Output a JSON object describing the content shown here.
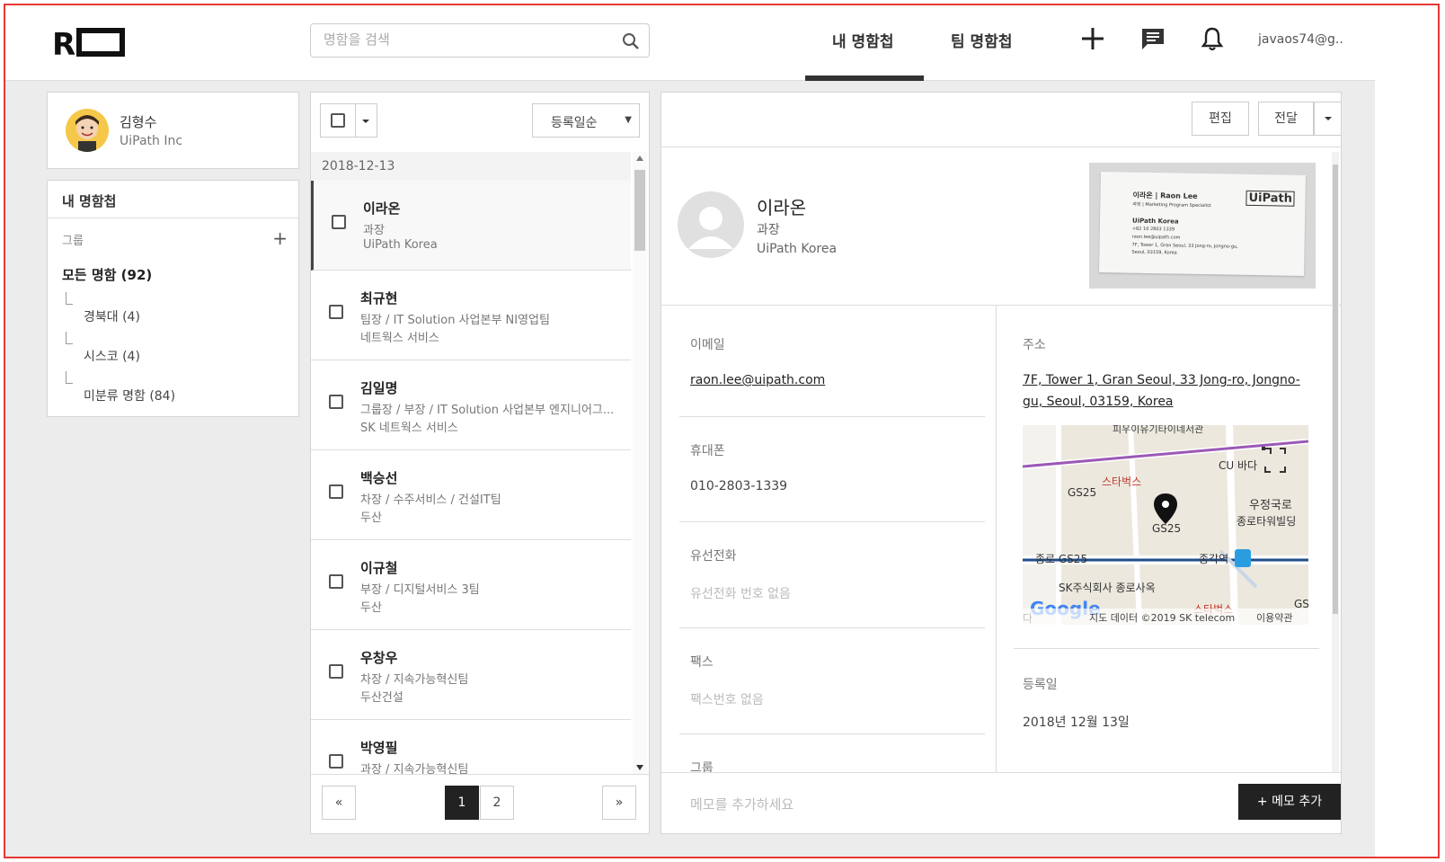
{
  "header": {
    "logo_text": "RO",
    "search_placeholder": "명함을 검색",
    "tabs": [
      {
        "label": "내 명함첩",
        "active": true
      },
      {
        "label": "팀 명함첩",
        "active": false
      }
    ],
    "user_email": "javaos74@g.."
  },
  "profile": {
    "name": "김형수",
    "company": "UiPath Inc"
  },
  "groups": {
    "title": "내 명함첩",
    "group_label": "그룹",
    "all_cards": "모든 명함",
    "all_count": "(92)",
    "items": [
      {
        "label": "경북대",
        "count": "(4)"
      },
      {
        "label": "시스코",
        "count": "(4)"
      },
      {
        "label": "미분류 명함",
        "count": "(84)"
      }
    ]
  },
  "list": {
    "sort_label": "등록일순",
    "date_header": "2018-12-13",
    "cards": [
      {
        "name": "이라온",
        "title": "과장",
        "company": "UiPath Korea"
      },
      {
        "name": "최규현",
        "title": "팀장 / IT Solution 사업본부 NI영업팀",
        "company": "네트웍스 서비스"
      },
      {
        "name": "김일명",
        "title": "그룹장 / 부장 / IT Solution 사업본부 엔지니어그...",
        "company": "SK 네트웍스 서비스"
      },
      {
        "name": "백승선",
        "title": "차장 / 수주서비스 / 건설IT팀",
        "company": "두산"
      },
      {
        "name": "이규철",
        "title": "부장 / 디지털서비스 3팀",
        "company": "두산"
      },
      {
        "name": "우창우",
        "title": "차장 / 지속가능혁신팀",
        "company": "두산건설"
      },
      {
        "name": "박영필",
        "title": "과장 / 지속가능혁신팀",
        "company": ""
      }
    ],
    "pager": {
      "prev": "«",
      "pages": [
        "1",
        "2"
      ],
      "current": "1",
      "next": "»"
    }
  },
  "detail": {
    "buttons": {
      "edit": "편집",
      "forward": "전달"
    },
    "name": "이라온",
    "title": "과장",
    "company": "UiPath Korea",
    "business_card": {
      "line1": "이라온 | Raon Lee",
      "line2": "과장 | Marketing Program Specialist",
      "logo": "UiPath",
      "company": "UiPath Korea",
      "phone": "+82 10 2803 1339",
      "email": "raon.lee@uipath.com",
      "addr1": "7F, Tower 1, Gran Seoul, 33 Jong-ro, Jongno-gu,",
      "addr2": "Seoul, 03159, Korea"
    },
    "email_label": "이메일",
    "email": "raon.lee@uipath.com",
    "mobile_label": "휴대폰",
    "mobile": "010-2803-1339",
    "phone_label": "유선전화",
    "phone_empty": "유선전화 번호 없음",
    "fax_label": "팩스",
    "fax_empty": "팩스번호 없음",
    "group_label": "그룹",
    "address_label": "주소",
    "address_line1": "7F, Tower 1, Gran Seoul, 33 Jong-ro, Jongno-",
    "address_line2": "gu, Seoul, 03159, Korea",
    "registered_label": "등록일",
    "registered": "2018년 12월 13일",
    "memo_placeholder": "메모를 추가하세요",
    "memo_button": "+ 메모 추가"
  },
  "map": {
    "labels": {
      "top": "피우이유기타이네서관",
      "starbucks1": "스타벅스",
      "gs25_a": "GS25",
      "gs25_b": "GS25",
      "gs25_c": "종로 GS25",
      "cu": "CU 바다",
      "post": "우정국로",
      "tower": "종로타워빌딩",
      "station": "종각역",
      "sk": "SK주식회사 종로사옥",
      "starbucks2": "스타벅스",
      "gs_edge": "GS",
      "jae": "다",
      "google": "Google",
      "copyright": "지도 데이터 ©2019 SK telecom",
      "terms": "이용약관"
    },
    "colors": {
      "line_purple": "#9b59b6",
      "line_blue": "#1f4e8c",
      "pin": "#111111"
    }
  }
}
